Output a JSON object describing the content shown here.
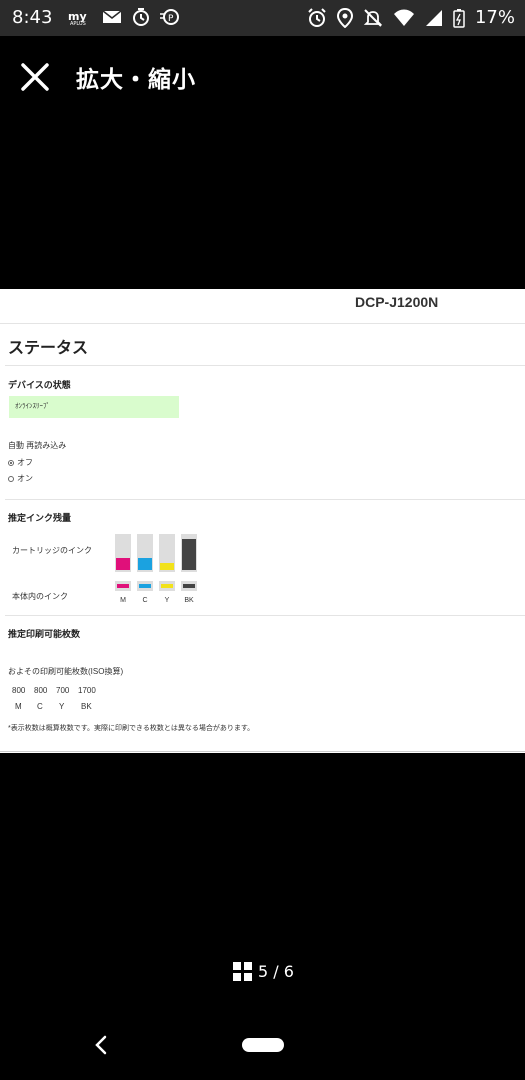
{
  "status_bar": {
    "time": "8:43",
    "battery": "17%",
    "icons_left": [
      "my-aplus-icon",
      "mail-icon",
      "timer-icon",
      "payment-icon"
    ],
    "icons_right": [
      "alarm-icon",
      "location-icon",
      "bell-off-icon",
      "wifi-icon",
      "signal-icon",
      "battery-icon"
    ]
  },
  "header": {
    "title": "拡大・縮小"
  },
  "document": {
    "model": "DCP-J1200N",
    "heading": "ステータス",
    "device_status": {
      "title": "デバイスの状態",
      "value": "ｵﾝﾗｲﾝｽﾘｰﾌﾟ"
    },
    "auto_reload": {
      "label": "自動 再読み込み",
      "options": [
        {
          "label": "オフ",
          "selected": true
        },
        {
          "label": "オン",
          "selected": false
        }
      ]
    },
    "ink": {
      "title": "推定インク残量",
      "cartridge_label": "カートリッジのインク",
      "body_label": "本体内のインク",
      "colors": [
        {
          "name": "M",
          "color": "#e0107a",
          "level": 0.35
        },
        {
          "name": "C",
          "color": "#1ba2e0",
          "level": 0.35
        },
        {
          "name": "Y",
          "color": "#f2e21a",
          "level": 0.2
        },
        {
          "name": "BK",
          "color": "#444444",
          "level": 0.9
        }
      ]
    },
    "print_count": {
      "title": "推定印刷可能枚数",
      "subtitle": "およその印刷可能枚数(ISO換算)",
      "values": [
        "800",
        "800",
        "700",
        "1700"
      ],
      "labels": [
        "M",
        "C",
        "Y",
        "BK"
      ],
      "note": "*表示枚数は概算枚数です。実際に印刷できる枚数とは異なる場合があります。"
    }
  },
  "pager": {
    "text": "5 / 6"
  }
}
